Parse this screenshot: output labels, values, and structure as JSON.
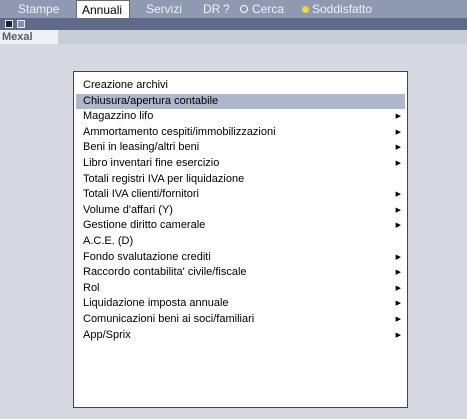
{
  "menubar": {
    "items": [
      {
        "label": "Stampe"
      },
      {
        "label": "Annuali"
      },
      {
        "label": "Servizi"
      },
      {
        "label": "DR"
      },
      {
        "label": "?"
      },
      {
        "label": "Cerca"
      },
      {
        "label": "Soddisfatto"
      }
    ]
  },
  "tab": {
    "label": "Mexal"
  },
  "menu": {
    "items": [
      {
        "label": "Creazione archivi",
        "submenu": false
      },
      {
        "label": "Chiusura/apertura contabile",
        "submenu": false
      },
      {
        "label": "Magazzino lifo",
        "submenu": true
      },
      {
        "label": "Ammortamento cespiti/immobilizzazioni",
        "submenu": true
      },
      {
        "label": "Beni in leasing/altri beni",
        "submenu": true
      },
      {
        "label": "Libro inventari fine esercizio",
        "submenu": true
      },
      {
        "label": "Totali registri IVA per liquidazione",
        "submenu": false
      },
      {
        "label": "Totali IVA clienti/fornitori",
        "submenu": true
      },
      {
        "label": "Volume d'affari (Y)",
        "submenu": true
      },
      {
        "label": "Gestione diritto camerale",
        "submenu": true
      },
      {
        "label": "A.C.E. (D)",
        "submenu": false
      },
      {
        "label": "Fondo svalutazione crediti",
        "submenu": true
      },
      {
        "label": "Raccordo contabilita' civile/fiscale",
        "submenu": true
      },
      {
        "label": "Rol",
        "submenu": true
      },
      {
        "label": "Liquidazione imposta annuale",
        "submenu": true
      },
      {
        "label": "Comunicazioni beni ai soci/familiari",
        "submenu": true
      },
      {
        "label": "App/Sprix",
        "submenu": true
      }
    ],
    "arrow": "▶",
    "highlight_color": "#aeb7cc"
  },
  "colors": {
    "menubar": "#8f9ab2",
    "toolbar": "#5f6b86",
    "background": "#d6d9e2"
  }
}
